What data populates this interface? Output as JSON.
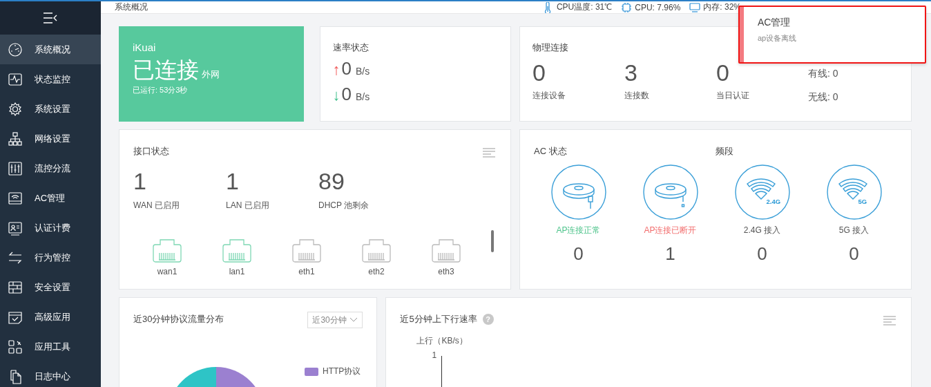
{
  "sidebar": {
    "items": [
      {
        "label": "系统概况",
        "selected": true
      },
      {
        "label": "状态监控",
        "selected": false
      },
      {
        "label": "系统设置",
        "selected": false
      },
      {
        "label": "网络设置",
        "selected": false
      },
      {
        "label": "流控分流",
        "selected": false
      },
      {
        "label": "AC管理",
        "selected": false
      },
      {
        "label": "认证计费",
        "selected": false
      },
      {
        "label": "行为管控",
        "selected": false
      },
      {
        "label": "安全设置",
        "selected": false
      },
      {
        "label": "高级应用",
        "selected": false
      },
      {
        "label": "应用工具",
        "selected": false
      },
      {
        "label": "日志中心",
        "selected": false
      }
    ]
  },
  "top_bar": {
    "breadcrumb": "系统概况",
    "stats": [
      {
        "label": "CPU温度: 31℃"
      },
      {
        "label": "CPU: 7.96%"
      },
      {
        "label": "内存: 32%"
      }
    ]
  },
  "wan_card": {
    "brand": "iKuai",
    "status": "已连接",
    "suffix": "外网",
    "uptime": "已运行: 53分3秒"
  },
  "speed_card": {
    "title": "速率状态",
    "rows": [
      {
        "kind": "up",
        "arrow": "↑",
        "value": "0",
        "unit": "B/s"
      },
      {
        "kind": "down",
        "arrow": "↓",
        "value": "0",
        "unit": "B/s"
      }
    ]
  },
  "physical_card": {
    "title": "物理连接",
    "stats": [
      {
        "value": "0",
        "label": "连接设备"
      },
      {
        "value": "3",
        "label": "连接数"
      },
      {
        "value": "0",
        "label": "当日认证"
      }
    ],
    "side": [
      "有线: 0",
      "无线: 0"
    ]
  },
  "interface_card": {
    "title": "接口状态",
    "stats": [
      {
        "value": "1",
        "label": "WAN 已启用"
      },
      {
        "value": "1",
        "label": "LAN 已启用"
      },
      {
        "value": "89",
        "label": "DHCP 池剩余"
      }
    ],
    "ports": [
      {
        "name": "wan1",
        "connected": true
      },
      {
        "name": "lan1",
        "connected": true
      },
      {
        "name": "eth1",
        "connected": false
      },
      {
        "name": "eth2",
        "connected": false
      },
      {
        "name": "eth3",
        "connected": false
      }
    ]
  },
  "ac_card": {
    "title": "AC 状态",
    "band_title": "频段",
    "items": [
      {
        "kind": "ap-online",
        "label": "AP连接正常",
        "value": "0"
      },
      {
        "kind": "ap-offline",
        "label": "AP连接已断开",
        "value": "1"
      },
      {
        "kind": "band",
        "badge": "2.4G",
        "label": "2.4G 接入",
        "value": "0"
      },
      {
        "kind": "band",
        "badge": "5G",
        "label": "5G 接入",
        "value": "0"
      }
    ]
  },
  "protocol_card": {
    "title": "近30分钟协议流量分布",
    "range_select": "近30分钟",
    "legend": [
      {
        "label": "HTTP协议",
        "color": "#9b80d0"
      }
    ]
  },
  "rate_card": {
    "title": "近5分钟上下行速率",
    "help": "?",
    "axis_label": "上行（KB/s）",
    "tick": "1"
  },
  "notification": {
    "title": "AC管理",
    "message": "ap设备离线"
  }
}
